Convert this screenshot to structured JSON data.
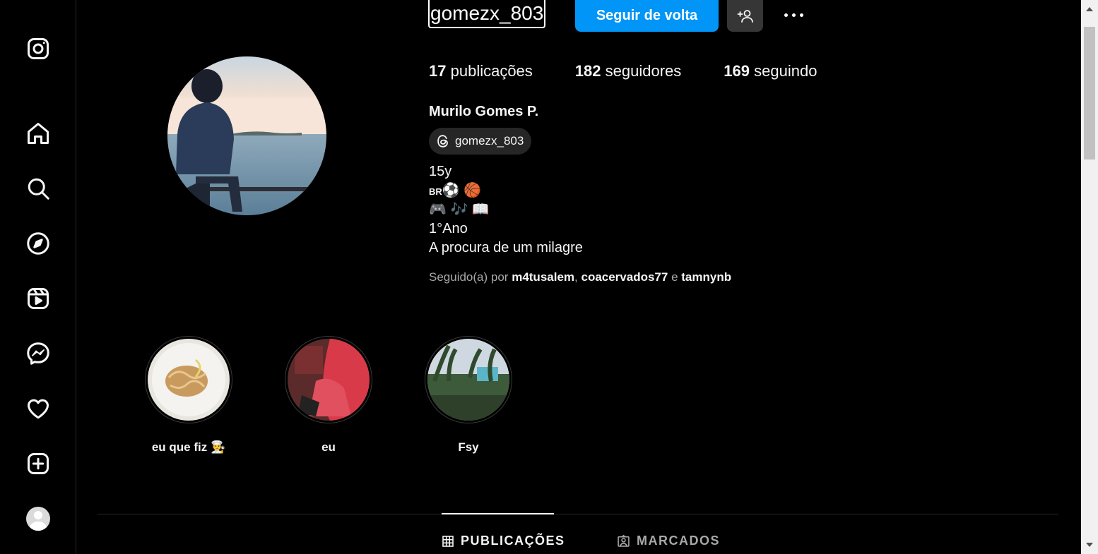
{
  "sidebar": {
    "items": [
      {
        "name": "instagram-logo-icon"
      },
      {
        "name": "home-icon"
      },
      {
        "name": "search-icon"
      },
      {
        "name": "explore-icon"
      },
      {
        "name": "reels-icon"
      },
      {
        "name": "messenger-icon"
      },
      {
        "name": "heart-icon"
      },
      {
        "name": "create-icon"
      },
      {
        "name": "avatar"
      }
    ]
  },
  "header": {
    "username": "gomezx_803",
    "follow_back_label": "Seguir de volta"
  },
  "stats": {
    "posts_count": "17",
    "posts_label": "publicações",
    "followers_count": "182",
    "followers_label": "seguidores",
    "following_count": "169",
    "following_label": "seguindo"
  },
  "profile": {
    "full_name": "Murilo Gomes P.",
    "threads_handle": "gomezx_803",
    "bio": {
      "line1": "15y",
      "line2_prefix": "BR",
      "line2_emoji": "⚽ 🏀",
      "line3": "🎮 🎶 📖",
      "line4": "1°Ano",
      "line5": "A procura de um milagre"
    },
    "followed_by": {
      "prefix": "Seguido(a) por",
      "user1": "m4tusalem",
      "sep1": ", ",
      "user2": "coacervados77",
      "sep2": " e ",
      "user3": "tamnynb"
    }
  },
  "highlights": [
    {
      "label": "eu que fiz 👨‍🍳"
    },
    {
      "label": "eu"
    },
    {
      "label": "Fsy"
    }
  ],
  "tabs": {
    "posts": "PUBLICAÇÕES",
    "tagged": "MARCADOS"
  },
  "colors": {
    "accent": "#0095f6",
    "background": "#000000",
    "secondary_button": "#363636"
  }
}
